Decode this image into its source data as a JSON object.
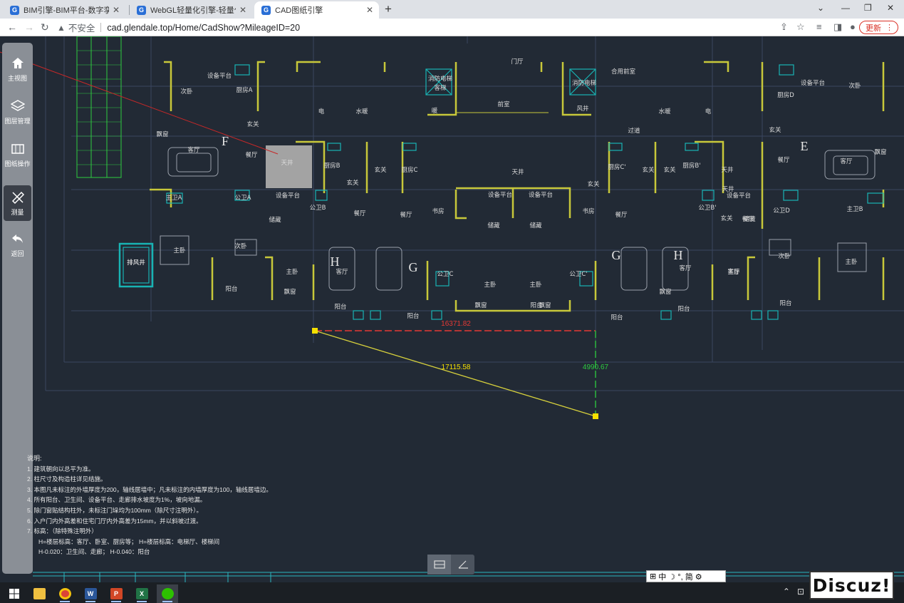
{
  "browser": {
    "tabs": [
      {
        "label": "BIM引擎-BIM平台-数字孪生引擎",
        "favicon": "G",
        "active": false
      },
      {
        "label": "WebGL轻量化引擎-轻量化CAD图",
        "favicon": "G",
        "active": false
      },
      {
        "label": "CAD图纸引擎",
        "favicon": "G",
        "active": true
      }
    ],
    "new_tab_icon": "plus-icon",
    "security_label": "不安全",
    "url": "cad.glendale.top/Home/CadShow?MileageID=20",
    "update_button": "更新"
  },
  "sidebar": {
    "items": [
      {
        "label": "主视图",
        "icon": "home-icon"
      },
      {
        "label": "图层管理",
        "icon": "layers-icon"
      },
      {
        "label": "图纸操作",
        "icon": "drawing-ops-icon"
      },
      {
        "label": "测量",
        "icon": "measure-icon",
        "active": true
      },
      {
        "label": "返回",
        "icon": "back-icon"
      }
    ]
  },
  "drawing": {
    "room_labels": [
      "门厅",
      "前室",
      "合用前室",
      "过道",
      "天井",
      "天井",
      "天井",
      "天井",
      "设备平台",
      "设备平台",
      "设备平台",
      "设备平台",
      "设备平台",
      "设备平台",
      "次卧",
      "次卧",
      "次卧",
      "次卧",
      "客厅",
      "客厅",
      "客厅",
      "客厅",
      "客厅",
      "厨房A",
      "厨房D",
      "厨房B",
      "厨房B'",
      "厨房C",
      "厨房C'",
      "餐厅",
      "餐厅",
      "餐厅",
      "餐厅",
      "餐厅",
      "餐厅",
      "玄关",
      "玄关",
      "玄关",
      "玄关",
      "玄关",
      "玄关",
      "玄关",
      "玄关",
      "主卫A",
      "主卫B",
      "公卫A",
      "公卫B",
      "公卫B'",
      "公卫C",
      "公卫C'",
      "公卫D",
      "主卧",
      "主卧",
      "主卧",
      "主卧",
      "主卧",
      "主卧",
      "阳台",
      "阳台",
      "阳台",
      "阳台",
      "阳台",
      "阳台",
      "阳台",
      "飘窗",
      "飘窗",
      "飘窗",
      "飘窗",
      "飘窗",
      "飘窗",
      "储藏",
      "储藏",
      "储藏",
      "储藏",
      "书房",
      "书房",
      "电",
      "电",
      "水暖",
      "水暖",
      "暖",
      "风井",
      "排风井",
      "消防电梯",
      "客梯",
      "消防电梯",
      "排风井"
    ],
    "unit_letters": [
      "F",
      "E",
      "H",
      "G",
      "G",
      "H"
    ],
    "measurements": {
      "horizontal": "16371.82",
      "diagonal": "17115.58",
      "vertical": "4990.67"
    },
    "colors": {
      "walls": "#c8c83a",
      "fixtures": "#18b4b4",
      "measure_horizontal": "#e53935",
      "measure_diagonal": "#d6d03c",
      "measure_vertical": "#2ecc40",
      "grid": "#3a4660"
    }
  },
  "notes": {
    "heading": "说明:",
    "items": [
      "1. 建筑朝向以总平为准。",
      "2. 柱尺寸及构造柱详见结施。",
      "3. 本图凡未标注的外墙厚度为200，轴线居墙中；凡未标注的内墙厚度为100，轴线居墙边。",
      "4. 所有阳台、卫生间、设备平台、走廊排水坡度为1%，坡向地漏。",
      "5. 除门窗贴结构柱外，未标注门垛均为100mm（除尺寸注明外）。",
      "6. 入户门内外高差和住宅门厅内外高差为15mm，并以斜坡过渡。",
      "7. 标高：（除特殊注明外）"
    ],
    "elevations": [
      "H=楼层标高：客厅、卧室、厨房等；   H=楼层标高：电梯厅、楼梯间",
      "H-0.020：卫生间、走廊；      H-0.040：阳台"
    ]
  },
  "bottom_tools": [
    {
      "icon": "horizontal-measure-icon",
      "active": true
    },
    {
      "icon": "angle-measure-icon",
      "active": false
    }
  ],
  "ime": {
    "text": "中 ☽ °, 简 ⚙"
  },
  "taskbar": {
    "apps": [
      {
        "icon": "windows-start-icon"
      },
      {
        "icon": "file-explorer-icon"
      },
      {
        "icon": "chrome-icon",
        "open": true
      },
      {
        "icon": "word-icon",
        "open": true
      },
      {
        "icon": "powerpoint-icon",
        "open": true
      },
      {
        "icon": "excel-icon",
        "open": true
      },
      {
        "icon": "wechat-icon",
        "open": true
      }
    ]
  },
  "watermark": {
    "text": "Discuz!"
  }
}
